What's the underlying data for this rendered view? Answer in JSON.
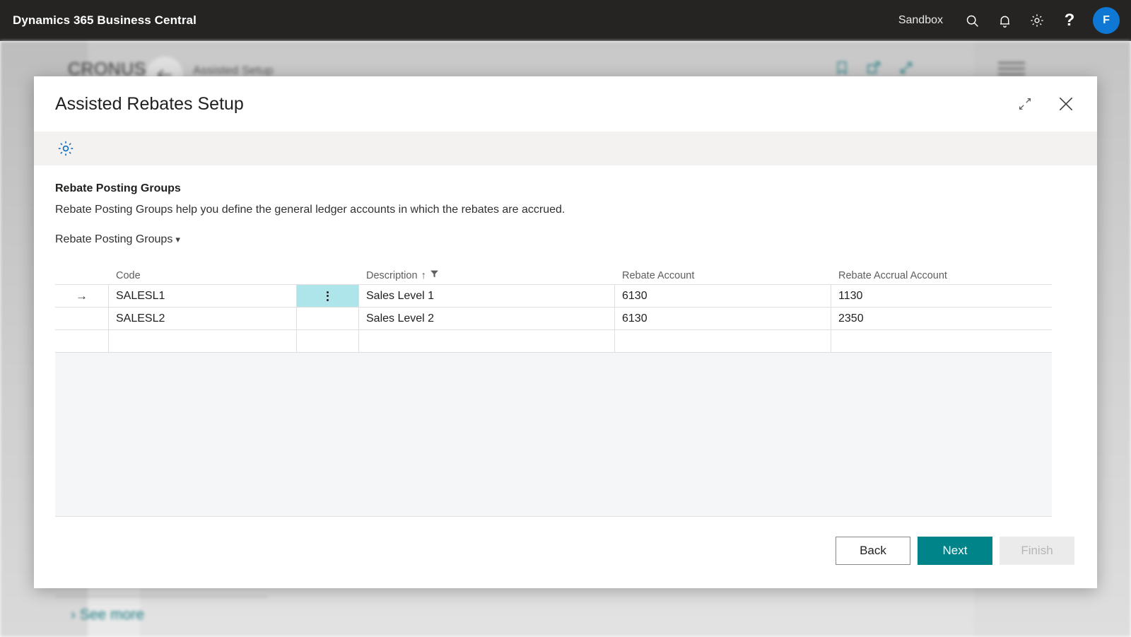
{
  "appbar": {
    "title": "Dynamics 365 Business Central",
    "environment": "Sandbox",
    "icons": [
      "search-icon",
      "notifications-bell-icon",
      "settings-gear-icon",
      "help-question-icon"
    ],
    "avatar_initial": "F",
    "avatar_color": "#0f78d4",
    "background_color": "#252423"
  },
  "background_page": {
    "company": "CRONUS",
    "breadcrumb": "Assisted Setup",
    "back_icon": "back-arrow-icon",
    "actions": [
      "bookmark-icon",
      "open-in-new-window-icon",
      "expand-icon"
    ],
    "menu_icon": "hamburger-menu-icon",
    "see_more": "See more",
    "accent_color": "#1b7b82"
  },
  "dialog": {
    "title": "Assisted Rebates Setup",
    "shrink_label": "Shrink",
    "close_label": "Close",
    "toolbar_icon": "settings-gear-icon",
    "toolbar_icon_color": "#0f6cbd",
    "section_heading": "Rebate Posting Groups",
    "section_description": "Rebate Posting Groups help you define the general ledger accounts in which the rebates are accrued.",
    "group_toggle_label": "Rebate Posting Groups",
    "group_toggle_chevron": "chevron-down-icon"
  },
  "grid": {
    "columns": [
      {
        "key": "arrow",
        "label": ""
      },
      {
        "key": "code",
        "label": "Code"
      },
      {
        "key": "menu",
        "label": ""
      },
      {
        "key": "description",
        "label": "Description",
        "sort": "↑",
        "filter_icon": "filter-funnel-icon"
      },
      {
        "key": "rebate_account",
        "label": "Rebate Account"
      },
      {
        "key": "rebate_accrual_account",
        "label": "Rebate Accrual Account"
      }
    ],
    "rows": [
      {
        "indicator": "→",
        "code": "SALESL1",
        "menu": "row-menu-icon",
        "description": "Sales Level 1",
        "rebate_account": "6130",
        "rebate_accrual_account": "1130",
        "selected_cell": "menu"
      },
      {
        "indicator": "",
        "code": "SALESL2",
        "menu": "",
        "description": "Sales Level 2",
        "rebate_account": "6130",
        "rebate_accrual_account": "2350",
        "selected_cell": ""
      },
      {
        "indicator": "",
        "code": "",
        "menu": "",
        "description": "",
        "rebate_account": "",
        "rebate_accrual_account": "",
        "selected_cell": ""
      }
    ],
    "selection_color": "#aee5ea"
  },
  "footer": {
    "back_label": "Back",
    "next_label": "Next",
    "finish_label": "Finish",
    "primary_color": "#008389",
    "finish_enabled": false
  }
}
